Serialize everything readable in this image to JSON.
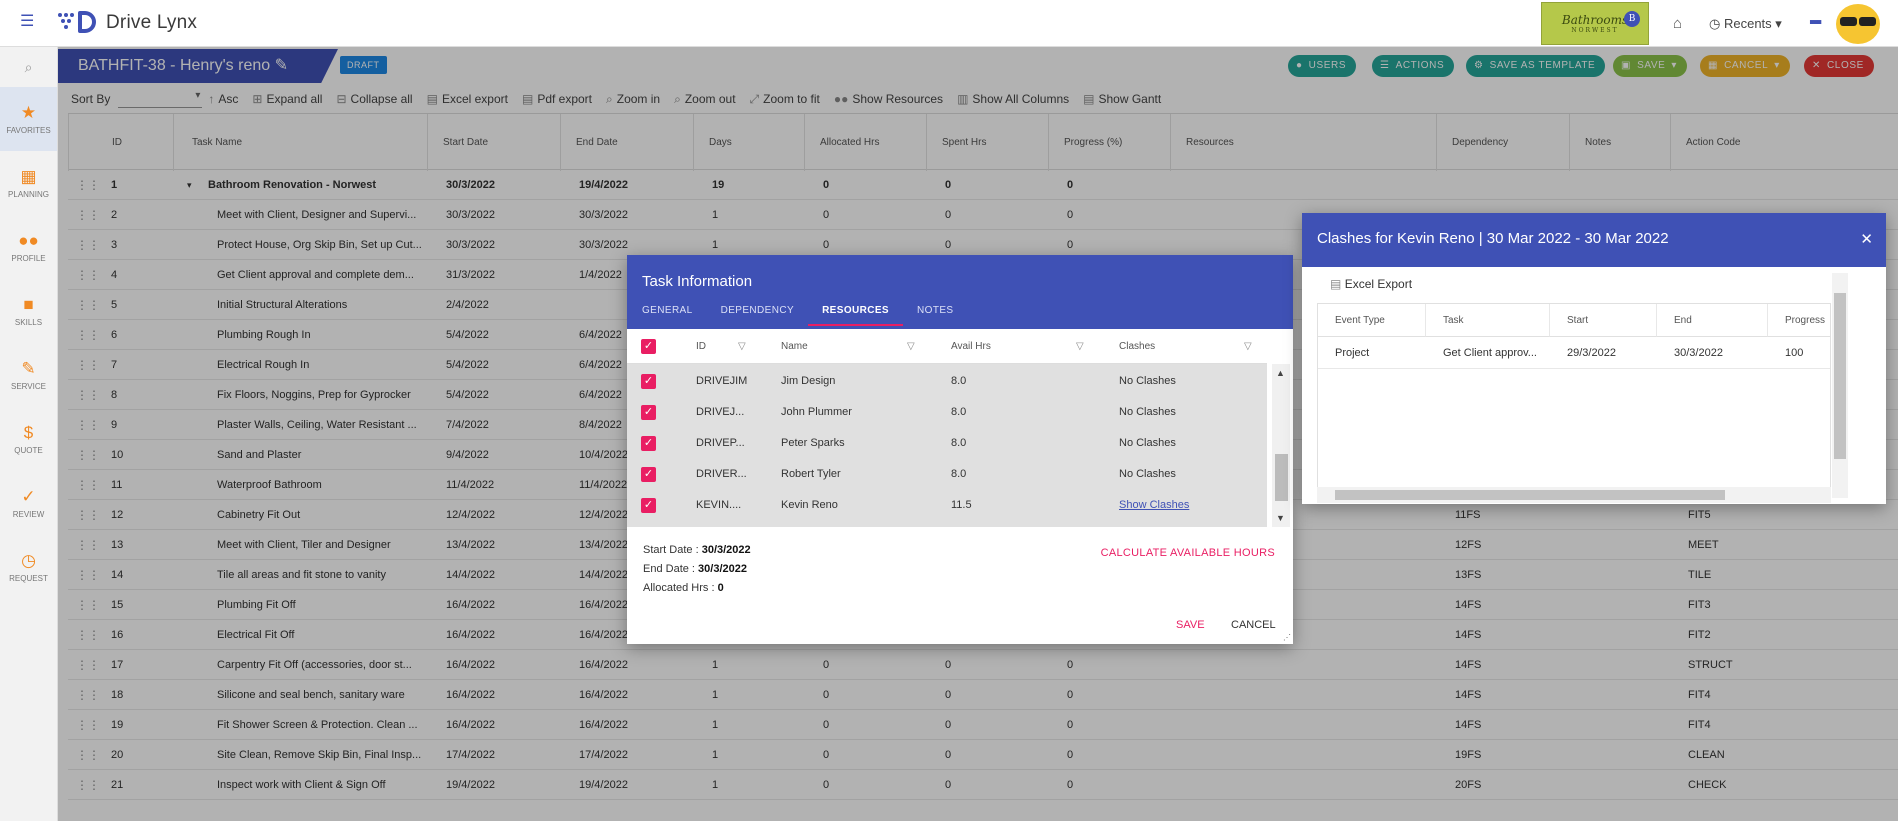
{
  "app": {
    "name": "Drive Lynx",
    "brand_line1": "Bathrooms",
    "brand_line2": "NORWEST",
    "recents_label": "Recents"
  },
  "sidebar": {
    "items": [
      {
        "label": "FAVORITES",
        "icon": "star-icon"
      },
      {
        "label": "PLANNING",
        "icon": "calendar-icon"
      },
      {
        "label": "PROFILE",
        "icon": "people-icon"
      },
      {
        "label": "SKILLS",
        "icon": "briefcase-icon"
      },
      {
        "label": "SERVICE",
        "icon": "wrench-icon"
      },
      {
        "label": "QUOTE",
        "icon": "dollar-icon"
      },
      {
        "label": "REVIEW",
        "icon": "check-icon"
      },
      {
        "label": "REQUEST",
        "icon": "clock-icon"
      }
    ]
  },
  "header": {
    "title": "BATHFIT-38 - Henry's reno",
    "status": "DRAFT",
    "buttons": {
      "users": "USERS",
      "actions": "ACTIONS",
      "save_template": "SAVE AS TEMPLATE",
      "save": "SAVE",
      "cancel": "CANCEL",
      "close": "CLOSE"
    }
  },
  "toolbar": {
    "sort_by": "Sort By",
    "asc": "Asc",
    "expand_all": "Expand all",
    "collapse_all": "Collapse all",
    "excel_export": "Excel export",
    "pdf_export": "Pdf export",
    "zoom_in": "Zoom in",
    "zoom_out": "Zoom out",
    "zoom_fit": "Zoom to fit",
    "show_resources": "Show Resources",
    "show_all_columns": "Show All Columns",
    "show_gantt": "Show Gantt"
  },
  "grid": {
    "columns": [
      "ID",
      "Task Name",
      "Start Date",
      "End Date",
      "Days",
      "Allocated Hrs",
      "Spent Hrs",
      "Progress (%)",
      "Resources",
      "Dependency",
      "Notes",
      "Action Code"
    ],
    "rows": [
      {
        "id": "1",
        "name": "Bathroom Renovation - Norwest",
        "start": "30/3/2022",
        "end": "19/4/2022",
        "days": "19",
        "alloc": "0",
        "spent": "0",
        "progress": "0",
        "dep": "",
        "code": "",
        "parent": true
      },
      {
        "id": "2",
        "name": "Meet with Client, Designer and Supervi...",
        "start": "30/3/2022",
        "end": "30/3/2022",
        "days": "1",
        "alloc": "0",
        "spent": "0",
        "progress": "0",
        "dep": "",
        "code": ""
      },
      {
        "id": "3",
        "name": "Protect House, Org Skip Bin, Set up Cut...",
        "start": "30/3/2022",
        "end": "30/3/2022",
        "days": "1",
        "alloc": "0",
        "spent": "0",
        "progress": "0",
        "dep": "",
        "code": ""
      },
      {
        "id": "4",
        "name": "Get Client approval and complete dem...",
        "start": "31/3/2022",
        "end": "1/4/2022",
        "days": "",
        "alloc": "",
        "spent": "",
        "progress": "",
        "dep": "",
        "code": ""
      },
      {
        "id": "5",
        "name": "Initial Structural Alterations",
        "start": "2/4/2022",
        "end": "",
        "days": "",
        "alloc": "",
        "spent": "",
        "progress": "",
        "dep": "",
        "code": ""
      },
      {
        "id": "6",
        "name": "Plumbing Rough In",
        "start": "5/4/2022",
        "end": "6/4/2022",
        "days": "",
        "alloc": "",
        "spent": "",
        "progress": "",
        "dep": "",
        "code": ""
      },
      {
        "id": "7",
        "name": "Electrical Rough In",
        "start": "5/4/2022",
        "end": "6/4/2022",
        "days": "",
        "alloc": "",
        "spent": "",
        "progress": "",
        "dep": "",
        "code": ""
      },
      {
        "id": "8",
        "name": "Fix Floors, Noggins, Prep for Gyprocker",
        "start": "5/4/2022",
        "end": "6/4/2022",
        "days": "",
        "alloc": "",
        "spent": "",
        "progress": "",
        "dep": "",
        "code": ""
      },
      {
        "id": "9",
        "name": "Plaster Walls, Ceiling, Water Resistant ...",
        "start": "7/4/2022",
        "end": "8/4/2022",
        "days": "",
        "alloc": "",
        "spent": "",
        "progress": "",
        "dep": "",
        "code": ""
      },
      {
        "id": "10",
        "name": "Sand and Plaster",
        "start": "9/4/2022",
        "end": "10/4/2022",
        "days": "",
        "alloc": "",
        "spent": "",
        "progress": "",
        "dep": "",
        "code": ""
      },
      {
        "id": "11",
        "name": "Waterproof Bathroom",
        "start": "11/4/2022",
        "end": "11/4/2022",
        "days": "",
        "alloc": "",
        "spent": "",
        "progress": "",
        "dep": "",
        "code": ""
      },
      {
        "id": "12",
        "name": "Cabinetry Fit Out",
        "start": "12/4/2022",
        "end": "12/4/2022",
        "days": "",
        "alloc": "",
        "spent": "",
        "progress": "",
        "dep": "11FS",
        "code": "FIT5"
      },
      {
        "id": "13",
        "name": "Meet with Client, Tiler and Designer",
        "start": "13/4/2022",
        "end": "13/4/2022",
        "days": "",
        "alloc": "",
        "spent": "",
        "progress": "",
        "dep": "12FS",
        "code": "MEET"
      },
      {
        "id": "14",
        "name": "Tile all areas and fit stone to vanity",
        "start": "14/4/2022",
        "end": "14/4/2022",
        "days": "",
        "alloc": "",
        "spent": "",
        "progress": "",
        "dep": "13FS",
        "code": "TILE"
      },
      {
        "id": "15",
        "name": "Plumbing Fit Off",
        "start": "16/4/2022",
        "end": "16/4/2022",
        "days": "",
        "alloc": "",
        "spent": "",
        "progress": "",
        "dep": "14FS",
        "code": "FIT3"
      },
      {
        "id": "16",
        "name": "Electrical Fit Off",
        "start": "16/4/2022",
        "end": "16/4/2022",
        "days": "",
        "alloc": "",
        "spent": "",
        "progress": "",
        "dep": "14FS",
        "code": "FIT2"
      },
      {
        "id": "17",
        "name": "Carpentry Fit Off (accessories, door st...",
        "start": "16/4/2022",
        "end": "16/4/2022",
        "days": "1",
        "alloc": "0",
        "spent": "0",
        "progress": "0",
        "dep": "14FS",
        "code": "STRUCT"
      },
      {
        "id": "18",
        "name": "Silicone and seal bench, sanitary ware",
        "start": "16/4/2022",
        "end": "16/4/2022",
        "days": "1",
        "alloc": "0",
        "spent": "0",
        "progress": "0",
        "dep": "14FS",
        "code": "FIT4"
      },
      {
        "id": "19",
        "name": "Fit Shower Screen & Protection. Clean ...",
        "start": "16/4/2022",
        "end": "16/4/2022",
        "days": "1",
        "alloc": "0",
        "spent": "0",
        "progress": "0",
        "dep": "14FS",
        "code": "FIT4"
      },
      {
        "id": "20",
        "name": "Site Clean, Remove Skip Bin, Final Insp...",
        "start": "17/4/2022",
        "end": "17/4/2022",
        "days": "1",
        "alloc": "0",
        "spent": "0",
        "progress": "0",
        "dep": "19FS",
        "code": "CLEAN"
      },
      {
        "id": "21",
        "name": "Inspect work with Client & Sign Off",
        "start": "19/4/2022",
        "end": "19/4/2022",
        "days": "1",
        "alloc": "0",
        "spent": "0",
        "progress": "0",
        "dep": "20FS",
        "code": "CHECK"
      }
    ]
  },
  "task_dialog": {
    "title": "Task Information",
    "tabs": [
      "GENERAL",
      "DEPENDENCY",
      "RESOURCES",
      "NOTES"
    ],
    "active_tab": "RESOURCES",
    "columns": [
      "ID",
      "Name",
      "Avail Hrs",
      "Clashes"
    ],
    "resources": [
      {
        "id": "DRIVEJIM",
        "name": "Jim Design",
        "hrs": "8.0",
        "clashes": "No Clashes"
      },
      {
        "id": "DRIVEJ...",
        "name": "John Plummer",
        "hrs": "8.0",
        "clashes": "No Clashes"
      },
      {
        "id": "DRIVEP...",
        "name": "Peter Sparks",
        "hrs": "8.0",
        "clashes": "No Clashes"
      },
      {
        "id": "DRIVER...",
        "name": "Robert Tyler",
        "hrs": "8.0",
        "clashes": "No Clashes"
      },
      {
        "id": "KEVIN....",
        "name": "Kevin Reno",
        "hrs": "11.5",
        "clashes": "Show Clashes"
      }
    ],
    "start_label": "Start Date :",
    "start_value": "30/3/2022",
    "end_label": "End Date :",
    "end_value": "30/3/2022",
    "alloc_label": "Allocated Hrs :",
    "alloc_value": "0",
    "calc_label": "CALCULATE AVAILABLE HOURS",
    "save_label": "SAVE",
    "cancel_label": "CANCEL"
  },
  "clash_dialog": {
    "title": "Clashes for Kevin Reno | 30 Mar 2022 - 30 Mar 2022",
    "export_label": "Excel Export",
    "columns": [
      "Event Type",
      "Task",
      "Start",
      "End",
      "Progress"
    ],
    "rows": [
      {
        "type": "Project",
        "task": "Get Client approv...",
        "start": "29/3/2022",
        "end": "30/3/2022",
        "progress": "100"
      }
    ]
  },
  "colors": {
    "primary": "#3f51b5",
    "accent": "#e91e63",
    "teal": "#26a69a",
    "green": "#8bc34a",
    "amber": "#f0b429",
    "red": "#e53935"
  }
}
